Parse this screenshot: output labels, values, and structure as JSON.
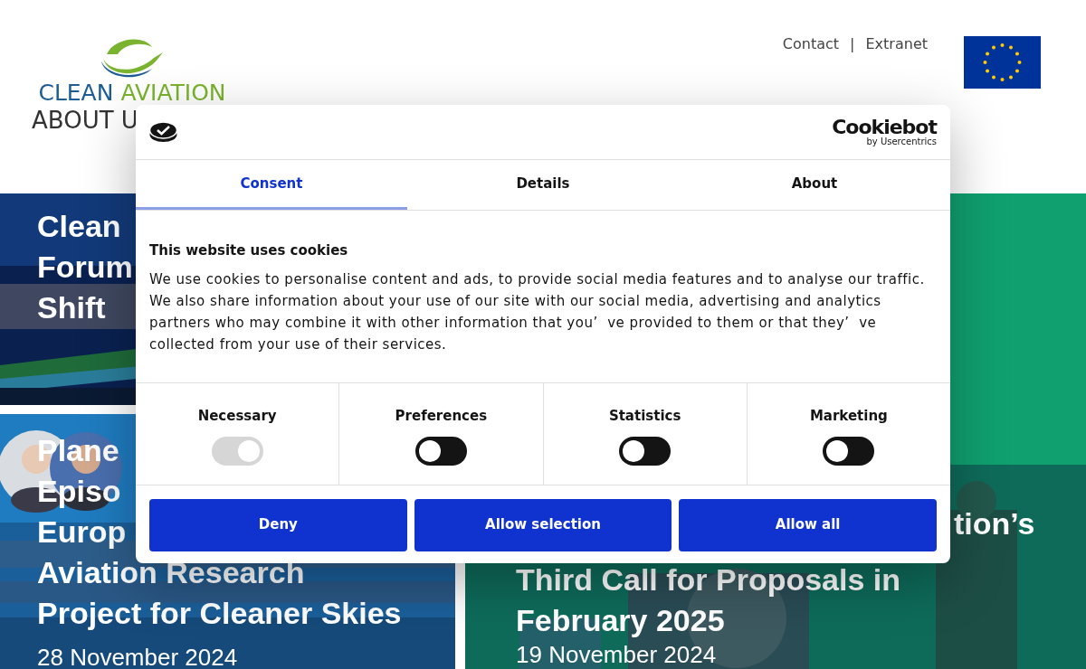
{
  "header": {
    "logo": {
      "first_word": "CLEAN",
      "second_word": "AVIATION"
    },
    "nav": [
      "ABOUT U"
    ],
    "links": [
      {
        "label": "Contact"
      },
      {
        "label": "Extranet"
      }
    ],
    "separator": "|"
  },
  "cards": [
    {
      "title_lines": [
        "Clean",
        "Forum",
        "Shift"
      ]
    },
    {
      "title_lines": [
        "Plane",
        "Episo",
        "Europ",
        "Aviation Research",
        "Project for Cleaner Skies"
      ],
      "date": "28 November 2024"
    },
    {
      "title_lines": [
        "tion’s",
        "Third Call for Proposals in",
        "February 2025"
      ],
      "date": "19 November 2024"
    }
  ],
  "cookie_dialog": {
    "brand": {
      "name": "Cookiebot",
      "byline": "by Usercentrics"
    },
    "tabs": [
      {
        "label": "Consent",
        "selected": true
      },
      {
        "label": "Details",
        "selected": false
      },
      {
        "label": "About",
        "selected": false
      }
    ],
    "heading": "This website uses cookies",
    "text": "We use cookies to personalise content and ads, to provide social media features and to analyse our traffic. We also share information about your use of our site with our social media, advertising and analytics partners who may combine it with other information that you’  ve provided to them or that they’  ve collected from your use of their services.",
    "categories": [
      {
        "label": "Necessary",
        "on": true,
        "disabled": true
      },
      {
        "label": "Preferences",
        "on": false,
        "disabled": false
      },
      {
        "label": "Statistics",
        "on": false,
        "disabled": false
      },
      {
        "label": "Marketing",
        "on": false,
        "disabled": false
      }
    ],
    "buttons": [
      "Deny",
      "Allow selection",
      "Allow all"
    ]
  }
}
